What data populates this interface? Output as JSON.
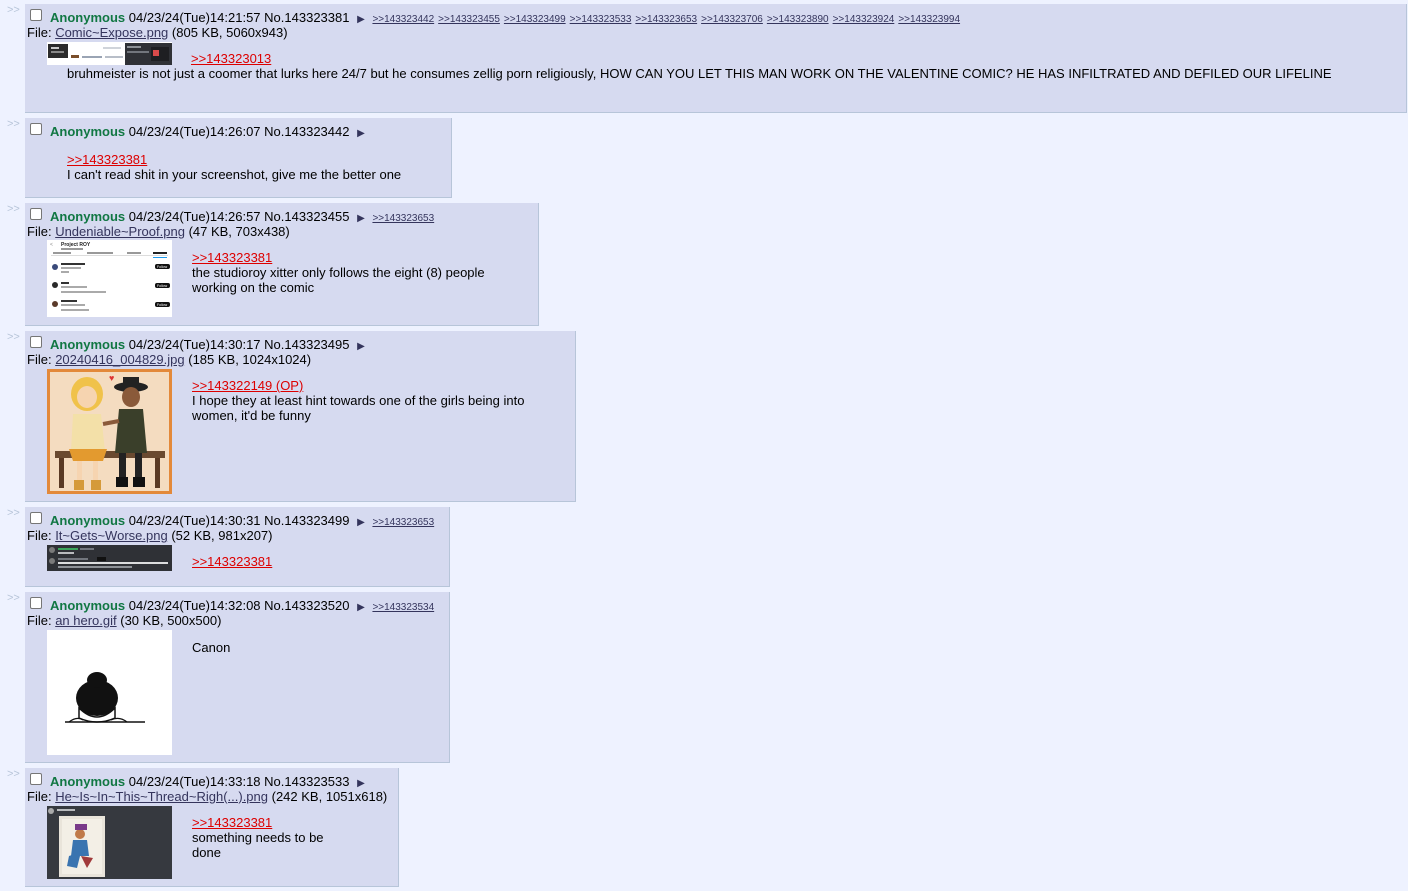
{
  "posts": [
    {
      "name": "Anonymous",
      "datetime": "04/23/24(Tue)14:21:57",
      "no": "No.143323381",
      "backlinks": [
        ">>143323442",
        ">>143323455",
        ">>143323499",
        ">>143323533",
        ">>143323653",
        ">>143323706",
        ">>143323890",
        ">>143323924",
        ">>143323994"
      ],
      "file_label": "File:",
      "file_name": "Comic~Expose.png",
      "file_info": "(805 KB, 5060x943)",
      "quote": ">>143323013",
      "text": "bruhmeister is not just a coomer that lurks here 24/7 but he consumes zellig porn religiously, HOW CAN YOU LET THIS MAN WORK ON THE VALENTINE COMIC? HE HAS INFILTRATED AND DEFILED OUR LIFELINE"
    },
    {
      "name": "Anonymous",
      "datetime": "04/23/24(Tue)14:26:07",
      "no": "No.143323442",
      "quote": ">>143323381",
      "text": "I can't read shit in your screenshot, give me the better one"
    },
    {
      "name": "Anonymous",
      "datetime": "04/23/24(Tue)14:26:57",
      "no": "No.143323455",
      "backlinks": [
        ">>143323653"
      ],
      "file_label": "File:",
      "file_name": "Undeniable~Proof.png",
      "file_info": "(47 KB, 703x438)",
      "quote": ">>143323381",
      "text": "the studioroy xitter only follows the eight (8) people working on the comic"
    },
    {
      "name": "Anonymous",
      "datetime": "04/23/24(Tue)14:30:17",
      "no": "No.143323495",
      "file_label": "File:",
      "file_name": "20240416_004829.jpg",
      "file_info": "(185 KB, 1024x1024)",
      "quote": ">>143322149 (OP)",
      "text": "I hope they at least hint towards one of the girls being into women, it'd be funny"
    },
    {
      "name": "Anonymous",
      "datetime": "04/23/24(Tue)14:30:31",
      "no": "No.143323499",
      "backlinks": [
        ">>143323653"
      ],
      "file_label": "File:",
      "file_name": "It~Gets~Worse.png",
      "file_info": "(52 KB, 981x207)",
      "quote": ">>143323381"
    },
    {
      "name": "Anonymous",
      "datetime": "04/23/24(Tue)14:32:08",
      "no": "No.143323520",
      "backlinks": [
        ">>143323534"
      ],
      "file_label": "File:",
      "file_name": "an hero.gif",
      "file_info": "(30 KB, 500x500)",
      "text": "Canon"
    },
    {
      "name": "Anonymous",
      "datetime": "04/23/24(Tue)14:33:18",
      "no": "No.143323533",
      "file_label": "File:",
      "file_name": "He~Is~In~This~Thread~Righ(...).png",
      "file_info": "(242 KB, 1051x618)",
      "quote": ">>143323381",
      "text": "something needs to be done"
    }
  ],
  "post_arrow": ">>",
  "caret": "▶",
  "thumb_text": {
    "project_title": "Project ROY",
    "follow": "Follow"
  },
  "colors": {
    "page_bg": "#eef2ff",
    "post_bg": "#d6daf0",
    "name": "#117743",
    "quotelink": "#dd0000",
    "link": "#34345c"
  }
}
